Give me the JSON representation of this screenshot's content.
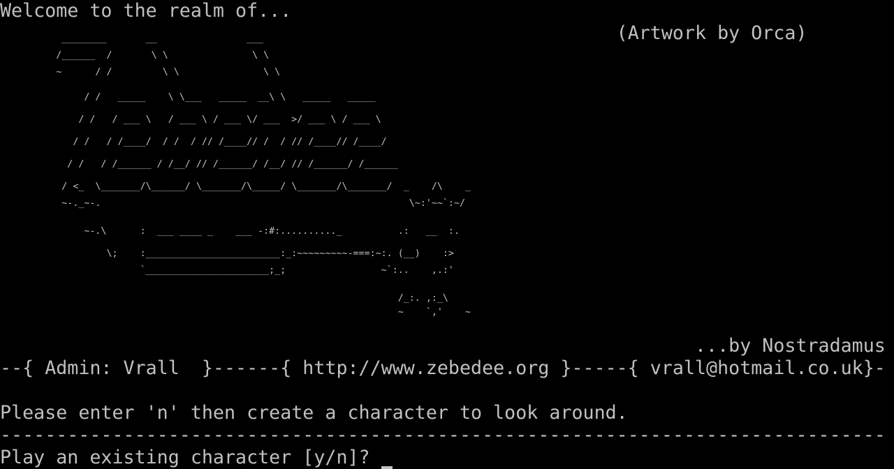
{
  "terminal": {
    "welcome": "Welcome to the realm of...",
    "credit_artwork": "                                                       (Artwork by Orca)",
    "ascii_art": [
      "           ________       __                ___",
      "          /______  /       \\ \\               \\ \\",
      "          ~      / /         \\ \\               \\ \\",
      "               / /   _____    \\ \\___   _____  __\\ \\   _____   _____",
      "              / /   / ___ \\   / ___ \\ / ___ \\/ ___  >/ ___ \\ / ___ \\",
      "             / /   / /____/  / /  / // /____// /  / // /____// /____/",
      "            / /   / /______ / /__/ // /______/ /__/ // /______/ /______",
      "           / <_  \\_______/\\______/ \\_______/\\_____/ \\_______/\\_______/  _    /\\    _",
      "           ~-._~-.                                                       \\~:'~~`:~/",
      "               ~-.\\      :  ___ ____ _    ___ -:#:.........._          .:   __  :.",
      "                   \\;    :________________________:_:~~~~~~~~~-===:~:. (__)    :>",
      "                         `______________________;_;                 ~`:..    ,.:'",
      "                                                                       /_:. ,:_\\",
      "                                                                       ~    `,'    ~"
    ],
    "credit_author": "                                                              ...by Nostradamus",
    "admin_banner": "--{ Admin: Vrall  }------{ http://www.zebedee.org }-----{ vrall@hotmail.co.uk}-",
    "blank": "",
    "instruction": "Please enter 'n' then create a character to look around.",
    "separator": "-------------------------------------------------------------------------------",
    "prompt": "Play an existing character [y/n]? "
  },
  "colors": {
    "background": "#000000",
    "foreground": "#c0c0c0"
  }
}
